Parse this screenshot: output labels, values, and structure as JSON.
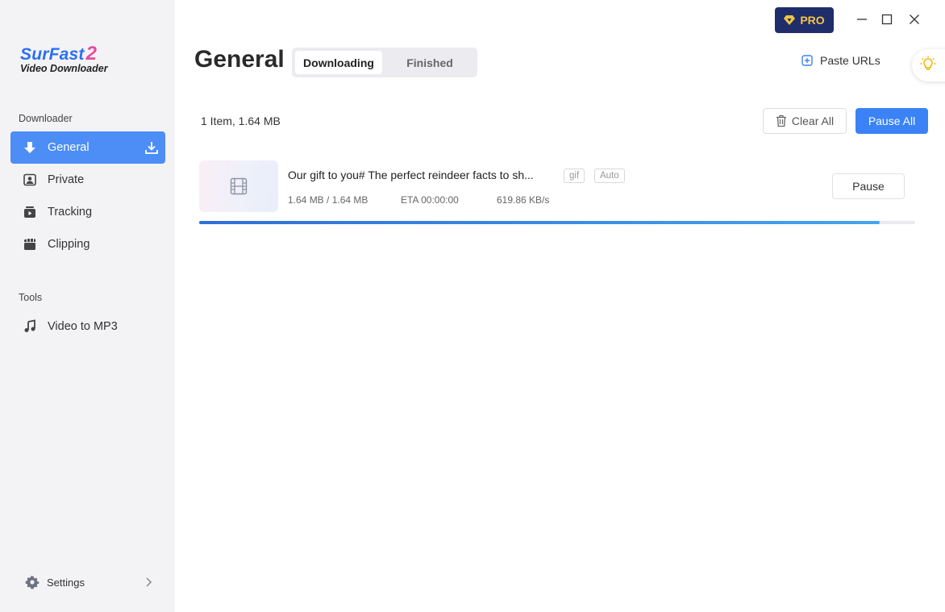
{
  "app": {
    "logo_name": "SurFast",
    "logo_version": "2",
    "logo_subtitle": "Video Downloader",
    "pro_label": "PRO"
  },
  "sidebar": {
    "downloader_label": "Downloader",
    "downloader_items": [
      {
        "label": "General",
        "icon": "download-arrow-icon",
        "active": true
      },
      {
        "label": "Private",
        "icon": "private-icon"
      },
      {
        "label": "Tracking",
        "icon": "tracking-icon"
      },
      {
        "label": "Clipping",
        "icon": "clipping-icon"
      }
    ],
    "tools_label": "Tools",
    "tools_items": [
      {
        "label": "Video to MP3",
        "icon": "music-note-icon"
      }
    ],
    "settings_label": "Settings"
  },
  "header": {
    "title": "General",
    "tabs": [
      {
        "label": "Downloading",
        "active": true
      },
      {
        "label": "Finished",
        "active": false
      }
    ],
    "paste_label": "Paste URLs"
  },
  "toolbar": {
    "summary": "1 Item, 1.64 MB",
    "clear_label": "Clear All",
    "pause_all_label": "Pause All"
  },
  "downloads": [
    {
      "title": "Our gift to you# The perfect reindeer facts to sh...",
      "format_tag": "gif",
      "quality_tag": "Auto",
      "size": "1.64 MB / 1.64 MB",
      "eta": "ETA 00:00:00",
      "speed": "619.86 KB/s",
      "action_label": "Pause",
      "progress_percent": 95
    }
  ],
  "colors": {
    "accent": "#3b82f6",
    "sidebar_active": "#4c8df6",
    "pro_bg": "#1f2d6b",
    "pro_fg": "#f5c542"
  }
}
